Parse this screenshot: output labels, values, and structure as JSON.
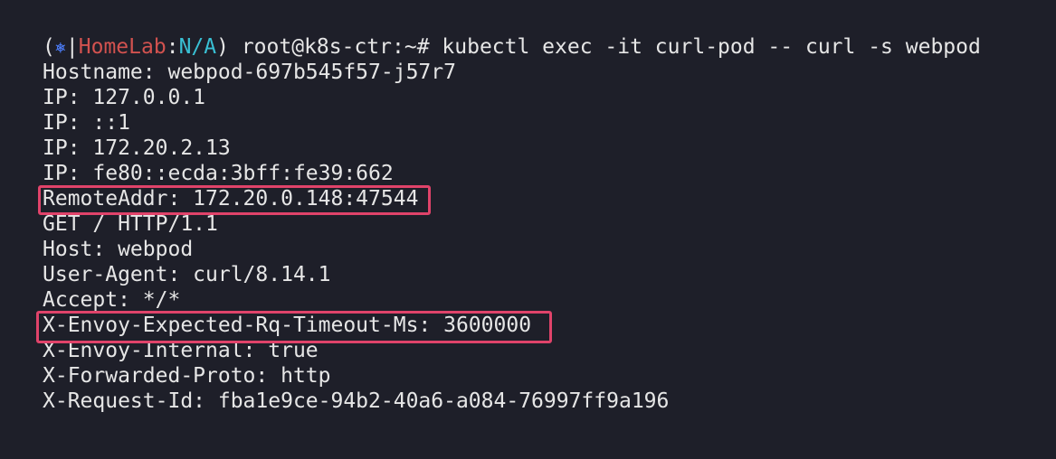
{
  "prompt": {
    "open_paren": "(",
    "icon": "kubernetes-helm-icon",
    "icon_glyph": "⎈",
    "separator": "|",
    "context": "HomeLab",
    "colon": ":",
    "namespace": "N/A",
    "close_paren": ")",
    "user_host": "root@k8s-ctr:~#",
    "command": "kubectl exec -it curl-pod -- curl -s webpod"
  },
  "output": [
    "Hostname: webpod-697b545f57-j57r7",
    "IP: 127.0.0.1",
    "IP: ::1",
    "IP: 172.20.2.13",
    "IP: fe80::ecda:3bff:fe39:662",
    "RemoteAddr: 172.20.0.148:47544",
    "GET / HTTP/1.1",
    "Host: webpod",
    "User-Agent: curl/8.14.1",
    "Accept: */*",
    "X-Envoy-Expected-Rq-Timeout-Ms: 3600000",
    "X-Envoy-Internal: true",
    "X-Forwarded-Proto: http",
    "X-Request-Id: fba1e9ce-94b2-40a6-a084-76997ff9a196"
  ],
  "colors": {
    "background": "#1e1f29",
    "text": "#e6e6e6",
    "context": "#d2524f",
    "namespace": "#39c0d4",
    "icon": "#4d7fff",
    "highlight": "#e0436a"
  }
}
